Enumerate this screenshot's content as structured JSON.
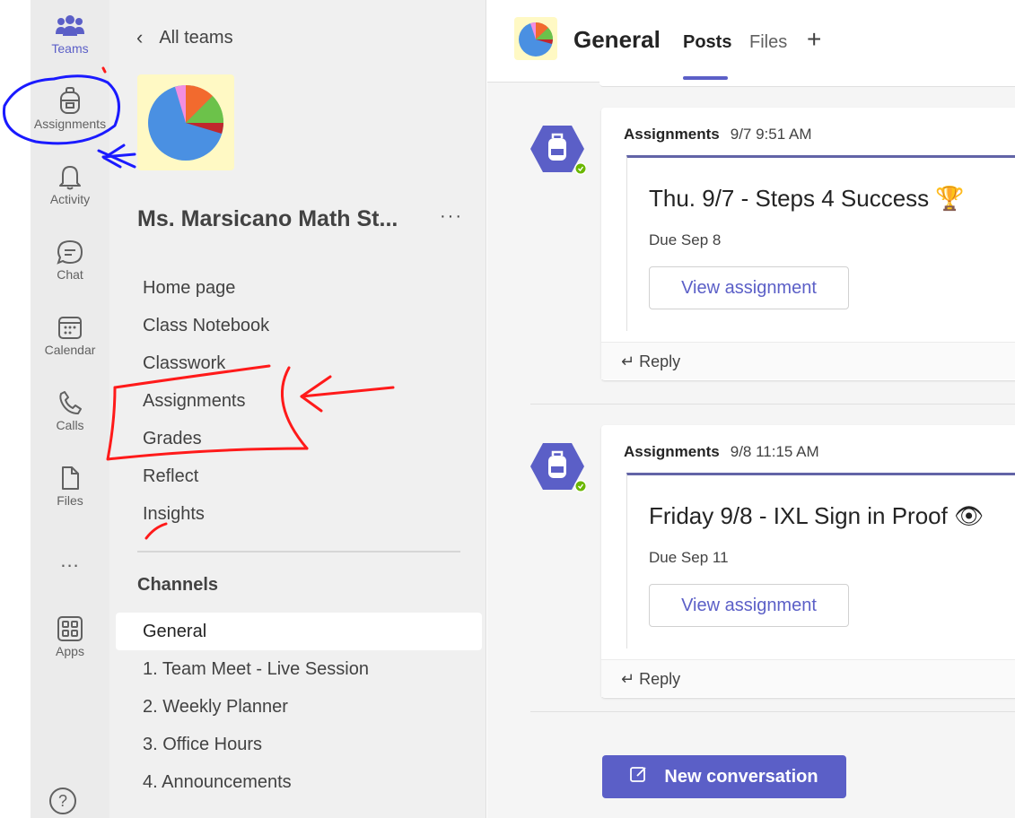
{
  "rail": {
    "items": [
      {
        "label": "Teams",
        "icon": "teams-icon"
      },
      {
        "label": "Assignments",
        "icon": "backpack-icon"
      },
      {
        "label": "Activity",
        "icon": "bell-icon"
      },
      {
        "label": "Chat",
        "icon": "chat-icon"
      },
      {
        "label": "Calendar",
        "icon": "calendar-icon"
      },
      {
        "label": "Calls",
        "icon": "phone-icon"
      },
      {
        "label": "Files",
        "icon": "file-icon"
      },
      {
        "label": "Apps",
        "icon": "apps-icon"
      }
    ],
    "more": "...",
    "help": "?"
  },
  "team": {
    "back_label": "All teams",
    "name": "Ms. Marsicano Math St...",
    "more": "···",
    "nav": [
      "Home page",
      "Class Notebook",
      "Classwork",
      "Assignments",
      "Grades",
      "Reflect",
      "Insights"
    ],
    "channels_heading": "Channels",
    "channels": [
      "General",
      "1. Team Meet - Live Session",
      "2. Weekly Planner",
      "3. Office Hours",
      "4. Announcements"
    ],
    "selected_channel": "General"
  },
  "channel": {
    "title": "General",
    "tabs": [
      "Posts",
      "Files"
    ],
    "active_tab": "Posts",
    "add_tab": "+"
  },
  "posts": [
    {
      "author": "Assignments",
      "time": "9/7 9:51 AM",
      "title": "Thu. 9/7 - Steps 4 Success 🏆",
      "due": "Due Sep 8",
      "button": "View assignment",
      "reply": "Reply"
    },
    {
      "author": "Assignments",
      "time": "9/8 11:15 AM",
      "title": "Friday 9/8 - IXL Sign in Proof 👁",
      "due": "Due Sep 11",
      "button": "View assignment",
      "reply": "Reply"
    }
  ],
  "new_conversation": "New conversation",
  "colors": {
    "accent": "#5b5fc7",
    "rail_bg": "#ebebeb",
    "pane_bg": "#f0f0f0",
    "annotation_blue": "#1a1aff",
    "annotation_red": "#ff1a1a"
  }
}
